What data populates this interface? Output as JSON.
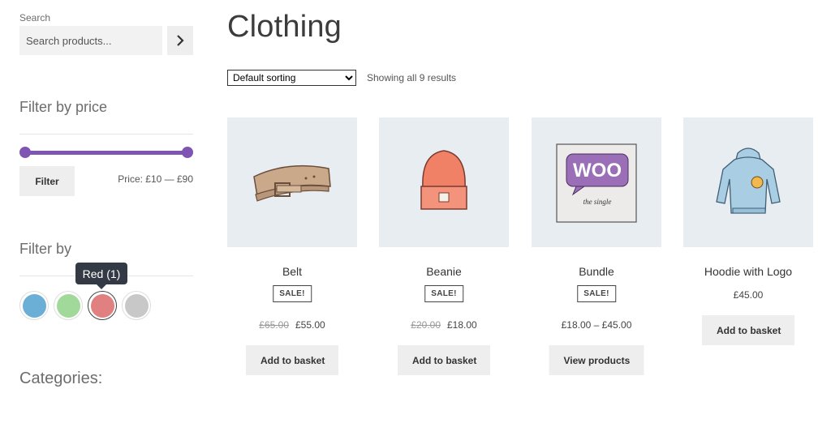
{
  "search": {
    "label": "Search",
    "placeholder": "Search products..."
  },
  "filter_price": {
    "title": "Filter by price",
    "button_label": "Filter",
    "price_text": "Price: £10 — £90"
  },
  "filter_by": {
    "title": "Filter by",
    "tooltip": "Red (1)",
    "swatches": [
      {
        "name": "blue",
        "color": "#6baed6"
      },
      {
        "name": "green",
        "color": "#a1d99b"
      },
      {
        "name": "red",
        "color": "#e08080",
        "active": true
      },
      {
        "name": "gray",
        "color": "#c8c8c8"
      }
    ]
  },
  "categories": {
    "title": "Categories:"
  },
  "main": {
    "title": "Clothing",
    "sort_selected": "Default sorting",
    "results": "Showing all 9 results"
  },
  "products": [
    {
      "name": "Belt",
      "sale_label": "SALE!",
      "old_price": "£65.00",
      "price": "£55.00",
      "button": "Add to basket"
    },
    {
      "name": "Beanie",
      "sale_label": "SALE!",
      "old_price": "£20.00",
      "price": "£18.00",
      "button": "Add to basket"
    },
    {
      "name": "Bundle",
      "sale_label": "SALE!",
      "price": "£18.00 – £45.00",
      "button": "View products",
      "logo_text": "WOO",
      "logo_subtext": "the single"
    },
    {
      "name": "Hoodie with Logo",
      "price": "£45.00",
      "button": "Add to basket"
    }
  ]
}
